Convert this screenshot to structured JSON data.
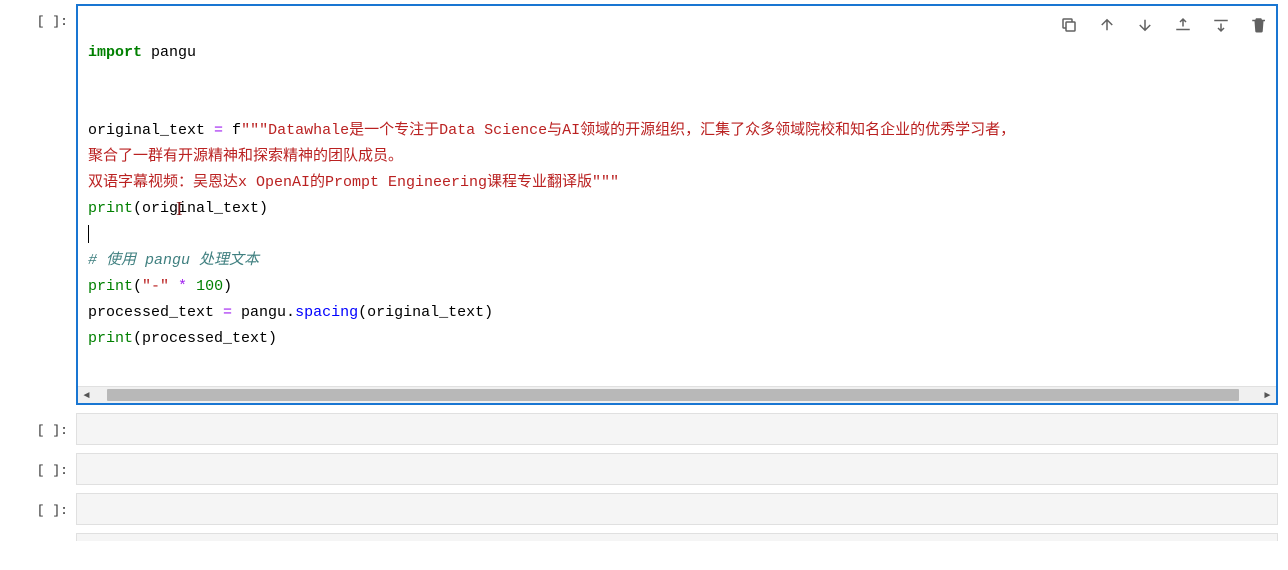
{
  "prompts": {
    "empty_prompt": "[ ]:"
  },
  "main_cell": {
    "code": {
      "l1": {
        "kw": "import",
        "mod": " pangu"
      },
      "l2": "",
      "l3": "",
      "l4": {
        "var": "original_text ",
        "op": "=",
        "fpre": " f",
        "str1": "\"\"\"Datawhale是一个专注于Data Science与AI领域的开源组织，汇集了众多领域院校和知名企业的优秀学习者，"
      },
      "l5": {
        "str": "聚合了一群有开源精神和探索精神的团队成员。"
      },
      "l6": {
        "str": "双语字幕视频：吴恩达x OpenAI的Prompt Engineering课程专业翻译版\"\"\""
      },
      "l7": {
        "fn": "print",
        "args": "(original_text)"
      },
      "l8_cursor": "|",
      "l9": {
        "com": "# 使用 pangu 处理文本"
      },
      "l10": {
        "fn": "print",
        "open": "(",
        "s": "\"-\"",
        "op": " * ",
        "num": "100",
        "close": ")"
      },
      "l11": {
        "var": "processed_text ",
        "op": "=",
        "mid": " pangu.",
        "meth": "spacing",
        "args": "(original_text)"
      },
      "l12": {
        "fn": "print",
        "args": "(processed_text)"
      }
    }
  },
  "toolbar": {
    "icons": {
      "duplicate": "duplicate-icon",
      "up": "arrow-up-icon",
      "down": "arrow-down-icon",
      "insert_above": "insert-above-icon",
      "insert_below": "insert-below-icon",
      "delete": "trash-icon"
    }
  },
  "text_cursor_glyph": "I"
}
